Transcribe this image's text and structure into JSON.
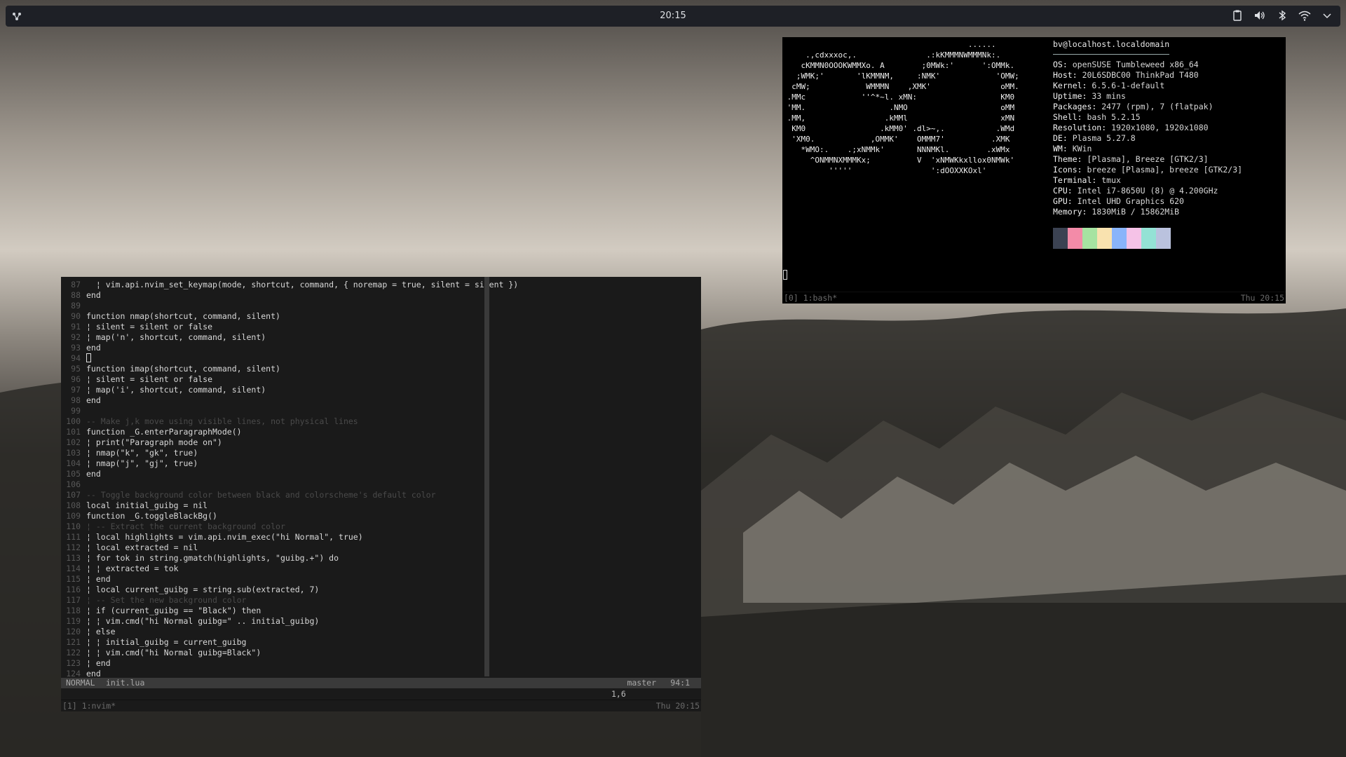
{
  "panel": {
    "clock": "20:15"
  },
  "nvim": {
    "lines": [
      {
        "n": "87",
        "t": "  ¦ vim.api.nvim_set_keymap(mode, shortcut, command, { noremap = true, silent = silent })"
      },
      {
        "n": "88",
        "t": "end"
      },
      {
        "n": "89",
        "t": ""
      },
      {
        "n": "90",
        "t": "function nmap(shortcut, command, silent)"
      },
      {
        "n": "91",
        "t": "¦ silent = silent or false"
      },
      {
        "n": "92",
        "t": "¦ map('n', shortcut, command, silent)"
      },
      {
        "n": "93",
        "t": "end"
      },
      {
        "n": "94",
        "t": "",
        "cursor": true
      },
      {
        "n": "95",
        "t": "function imap(shortcut, command, silent)"
      },
      {
        "n": "96",
        "t": "¦ silent = silent or false"
      },
      {
        "n": "97",
        "t": "¦ map('i', shortcut, command, silent)"
      },
      {
        "n": "98",
        "t": "end"
      },
      {
        "n": "99",
        "t": ""
      },
      {
        "n": "100",
        "t": "-- Make j,k move using visible lines, not physical lines",
        "comment": true
      },
      {
        "n": "101",
        "t": "function _G.enterParagraphMode()"
      },
      {
        "n": "102",
        "t": "¦ print(\"Paragraph mode on\")"
      },
      {
        "n": "103",
        "t": "¦ nmap(\"k\", \"gk\", true)"
      },
      {
        "n": "104",
        "t": "¦ nmap(\"j\", \"gj\", true)"
      },
      {
        "n": "105",
        "t": "end"
      },
      {
        "n": "106",
        "t": ""
      },
      {
        "n": "107",
        "t": "-- Toggle background color between black and colorscheme's default color",
        "comment": true
      },
      {
        "n": "108",
        "t": "local initial_guibg = nil"
      },
      {
        "n": "109",
        "t": "function _G.toggleBlackBg()"
      },
      {
        "n": "110",
        "t": "¦ -- Extract the current background color",
        "comment": true
      },
      {
        "n": "111",
        "t": "¦ local highlights = vim.api.nvim_exec(\"hi Normal\", true)"
      },
      {
        "n": "112",
        "t": "¦ local extracted = nil"
      },
      {
        "n": "113",
        "t": "¦ for tok in string.gmatch(highlights, \"guibg.+\") do"
      },
      {
        "n": "114",
        "t": "¦ ¦ extracted = tok"
      },
      {
        "n": "115",
        "t": "¦ end"
      },
      {
        "n": "116",
        "t": "¦ local current_guibg = string.sub(extracted, 7)"
      },
      {
        "n": "117",
        "t": "¦ -- Set the new background color",
        "comment": true
      },
      {
        "n": "118",
        "t": "¦ if (current_guibg == \"Black\") then"
      },
      {
        "n": "119",
        "t": "¦ ¦ vim.cmd(\"hi Normal guibg=\" .. initial_guibg)"
      },
      {
        "n": "120",
        "t": "¦ else"
      },
      {
        "n": "121",
        "t": "¦ ¦ initial_guibg = current_guibg"
      },
      {
        "n": "122",
        "t": "¦ ¦ vim.cmd(\"hi Normal guibg=Black\")"
      },
      {
        "n": "123",
        "t": "¦ end"
      },
      {
        "n": "124",
        "t": "end"
      }
    ],
    "status": {
      "mode": "NORMAL",
      "file": "init.lua",
      "branch": "master",
      "position": "94:1"
    },
    "cmdline_ruler": "1,6",
    "tmux": {
      "window": "[1] 1:nvim*",
      "clock": "Thu 20:15"
    }
  },
  "fetch": {
    "ascii": [
      "                                        ......",
      "     .,cdxxxoc,.               .:kKMMMNWMMMNk:.",
      "    cKMMN0OOOKWMMXo. A        ;0MWk:'      ':OMMk.",
      "   ;WMK;'       'lKMMNM,     :NMK'            'OMW;",
      "  cMW;            WMMMN    ,XMK'               oMM.",
      " .MMc            ''^*~l. xMN:                  KM0",
      " 'MM.                  .NMO                    oMM",
      " .MM,                 .kMMl                    xMN",
      "  KM0                .kMM0' .dl>~,.           .WMd",
      "  'XM0.            ,OMMK'    OMMM7'          .XMK",
      "    *WMO:.    .;xNMMk'       NNNMKl.        .xWMx",
      "      ^ONMMNXMMMKx;          V  'xNMWKkxllox0NMWk'",
      "          '''''                 ':dOOXXKOxl'"
    ],
    "user_host": "bv@localhost.localdomain",
    "info": [
      {
        "k": "OS",
        "v": "openSUSE Tumbleweed x86_64"
      },
      {
        "k": "Host",
        "v": "20L6SDBC00 ThinkPad T480"
      },
      {
        "k": "Kernel",
        "v": "6.5.6-1-default"
      },
      {
        "k": "Uptime",
        "v": "33 mins"
      },
      {
        "k": "Packages",
        "v": "2477 (rpm), 7 (flatpak)"
      },
      {
        "k": "Shell",
        "v": "bash 5.2.15"
      },
      {
        "k": "Resolution",
        "v": "1920x1080, 1920x1080"
      },
      {
        "k": "DE",
        "v": "Plasma 5.27.8"
      },
      {
        "k": "WM",
        "v": "KWin"
      },
      {
        "k": "Theme",
        "v": "[Plasma], Breeze [GTK2/3]"
      },
      {
        "k": "Icons",
        "v": "breeze [Plasma], breeze [GTK2/3]"
      },
      {
        "k": "Terminal",
        "v": "tmux"
      },
      {
        "k": "CPU",
        "v": "Intel i7-8650U (8) @ 4.200GHz"
      },
      {
        "k": "GPU",
        "v": "Intel UHD Graphics 620"
      },
      {
        "k": "Memory",
        "v": "1830MiB / 15862MiB"
      }
    ],
    "swatches": [
      "#3b4252",
      "#f38ba8",
      "#a6e3a1",
      "#f9e2af",
      "#89b4fa",
      "#f5c2e7",
      "#94e2d5",
      "#bac2de"
    ],
    "tmux": {
      "window": "[0] 1:bash*",
      "clock": "Thu 20:15"
    }
  }
}
